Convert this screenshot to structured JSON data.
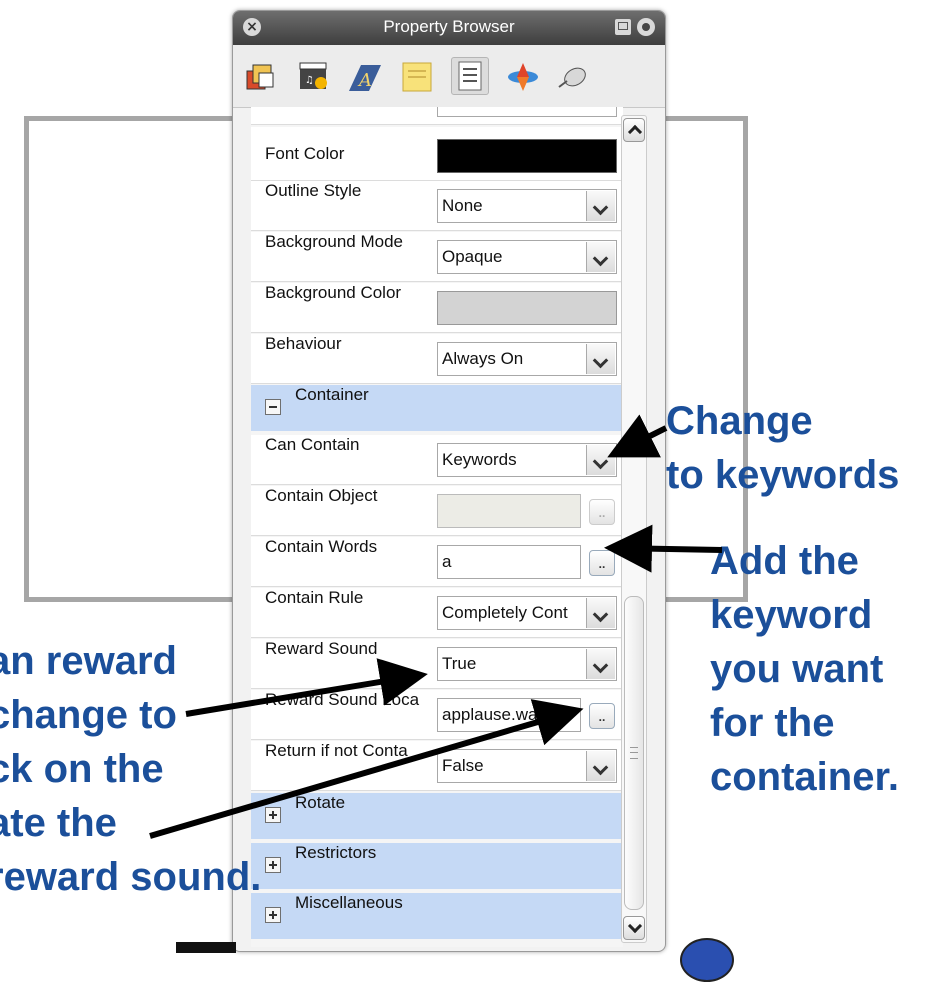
{
  "window": {
    "title": "Property Browser"
  },
  "toolbar": {
    "icons": [
      "objects-icon",
      "media-icon",
      "text-style-icon",
      "note-icon",
      "properties-icon",
      "spinner-icon",
      "mouse-icon"
    ]
  },
  "properties": {
    "font_color": {
      "label": "Font Color",
      "value_color": "#000000"
    },
    "outline_style": {
      "label": "Outline Style",
      "value": "None"
    },
    "background_mode": {
      "label": "Background Mode",
      "value": "Opaque"
    },
    "background_color": {
      "label": "Background Color",
      "value_color": "#d3d3d3"
    },
    "behaviour": {
      "label": "Behaviour",
      "value": "Always On"
    }
  },
  "container": {
    "section_label": "Container",
    "can_contain": {
      "label": "Can Contain",
      "value": "Keywords"
    },
    "contain_object": {
      "label": "Contain Object",
      "button": ".."
    },
    "contain_words": {
      "label": "Contain Words",
      "value": "a",
      "button": ".."
    },
    "contain_rule": {
      "label": "Contain Rule",
      "value": "Completely Cont"
    },
    "reward_sound": {
      "label": "Reward Sound",
      "value": "True"
    },
    "reward_sound_location": {
      "label": "Reward Sound Loca",
      "value": "applause.wav",
      "button": ".."
    },
    "return_if_not": {
      "label": "Return if not Conta",
      "value": "False"
    }
  },
  "sections": {
    "rotate": "Rotate",
    "restrictors": "Restrictors",
    "miscellaneous": "Miscellaneous"
  },
  "annotations": {
    "change_keywords": "Change\nto keywords",
    "add_keyword": "Add the\nkeyword\nyou want\nfor the\ncontainer.",
    "reward_note": "an reward\nchange to\nck on the\nate the\nreward sound."
  },
  "colors": {
    "accent_section": "#c5d9f5",
    "annotation_text": "#1b4f9a"
  }
}
